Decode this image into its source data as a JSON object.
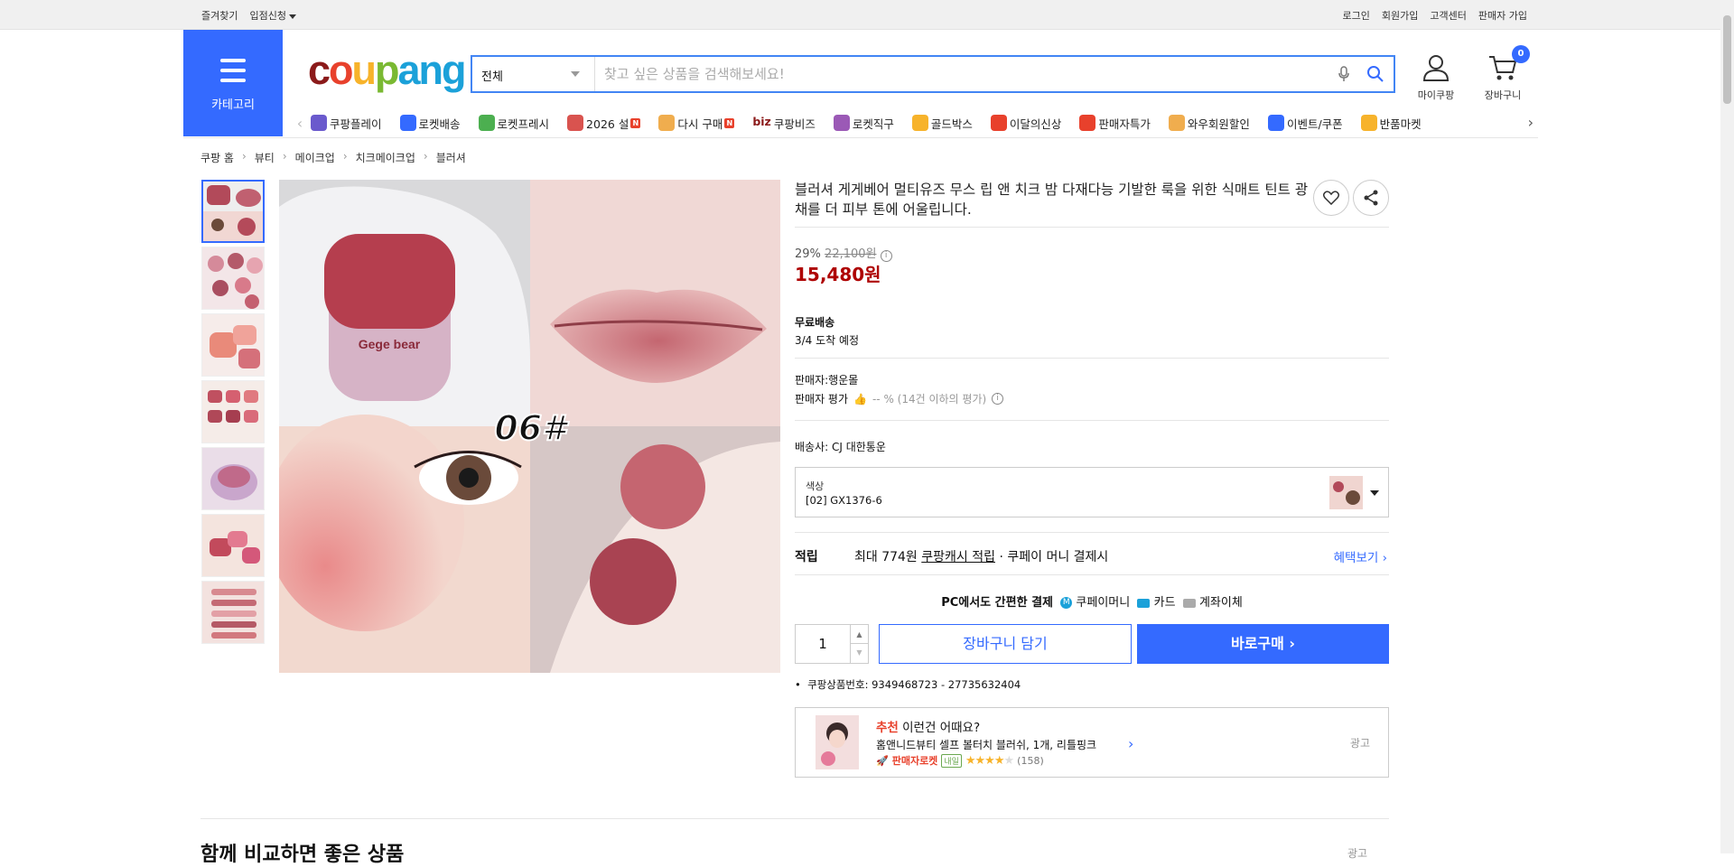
{
  "topbar": {
    "left": [
      "즐겨찾기",
      "입점신청"
    ],
    "right": [
      "로그인",
      "회원가입",
      "고객센터",
      "판매자 가입"
    ]
  },
  "header": {
    "category_label": "카테고리",
    "logo": [
      "c",
      "o",
      "u",
      "p",
      "ang"
    ],
    "search_scope": "전체",
    "search_placeholder": "찾고 싶은 상품을 검색해보세요!",
    "mycoupang": "마이쿠팡",
    "cart": "장바구니",
    "cart_count": "0"
  },
  "category_bar": [
    {
      "label": "쿠팡플레이",
      "icon": "play-icon",
      "color": "#6a5acd"
    },
    {
      "label": "로켓배송",
      "icon": "rocket-icon",
      "color": "#346aff"
    },
    {
      "label": "로켓프레시",
      "icon": "fresh-rocket-icon",
      "color": "#4caf50"
    },
    {
      "label": "2026 설",
      "icon": "gift-icon",
      "color": "#d9534f",
      "badge": "N"
    },
    {
      "label": "다시 구매",
      "icon": "home-icon",
      "color": "#f0ad4e",
      "badge": "N"
    },
    {
      "label": "쿠팡비즈",
      "icon": "biz-icon",
      "color": "#8b1a1a",
      "prefix": "biz"
    },
    {
      "label": "로켓직구",
      "icon": "global-icon",
      "color": "#9b59b6"
    },
    {
      "label": "골드박스",
      "icon": "goldbox-icon",
      "color": "#f7b32b"
    },
    {
      "label": "이달의신상",
      "icon": "new-bag-icon",
      "color": "#e8412c"
    },
    {
      "label": "판매자특가",
      "icon": "percent-icon",
      "color": "#e8412c"
    },
    {
      "label": "와우회원할인",
      "icon": "wow-icon",
      "color": "#f0ad4e"
    },
    {
      "label": "이벤트/쿠폰",
      "icon": "coupon-icon",
      "color": "#346aff"
    },
    {
      "label": "반품마켓",
      "icon": "market-icon",
      "color": "#f7b32b"
    }
  ],
  "breadcrumb": [
    "쿠팡 홈",
    "뷰티",
    "메이크업",
    "치크메이크업",
    "블러셔"
  ],
  "product": {
    "title": "블러셔 게게베어 멀티유즈 무스 립 앤 치크 밤 다재다능 기발한 룩을 위한 식매트 틴트 광채를 더 피부 톤에 어울립니다.",
    "discount_rate": "29%",
    "original_price": "22,100원",
    "price": "15,480원",
    "shipping_title": "무료배송",
    "arrival": "3/4 도착 예정",
    "seller": "판매자:행운몰",
    "seller_rating_label": "판매자 평가",
    "seller_rating_value": "-- % (14건 이하의 평가)",
    "courier": "배송사:  CJ 대한통운",
    "option_label": "색상",
    "option_value": "[02] GX1376-6",
    "reward_key": "적립",
    "reward_text_1": "최대 774원",
    "reward_text_link": "쿠팡캐시 적립",
    "reward_text_2": "· 쿠페이 머니 결제시",
    "reward_more": "혜택보기 ›",
    "pay_title": "PC에서도 간편한 결제",
    "pay_methods": [
      "쿠페이머니",
      "카드",
      "계좌이체"
    ],
    "quantity": "1",
    "cart_button": "장바구니 담기",
    "buy_button": "바로구매 ›",
    "product_number": "쿠팡상품번호: 9349468723 - 27735632404",
    "overlay_text": "06#",
    "brand_text": "Gege bear"
  },
  "recommend": {
    "prefix": "추천",
    "title": "이런건 어때요?",
    "item": "홈앤니드뷰티 셀프 볼터치 블러쉬, 1개, 리틀핑크",
    "badge1": "판매자로켓",
    "badge2": "내일",
    "rating": 4,
    "reviews": "(158)",
    "ad": "광고"
  },
  "bottom": {
    "section_title": "함께 비교하면 좋은 상품",
    "ad": "광고"
  },
  "colors": {
    "accent": "#346aff",
    "price": "#ae0000"
  }
}
